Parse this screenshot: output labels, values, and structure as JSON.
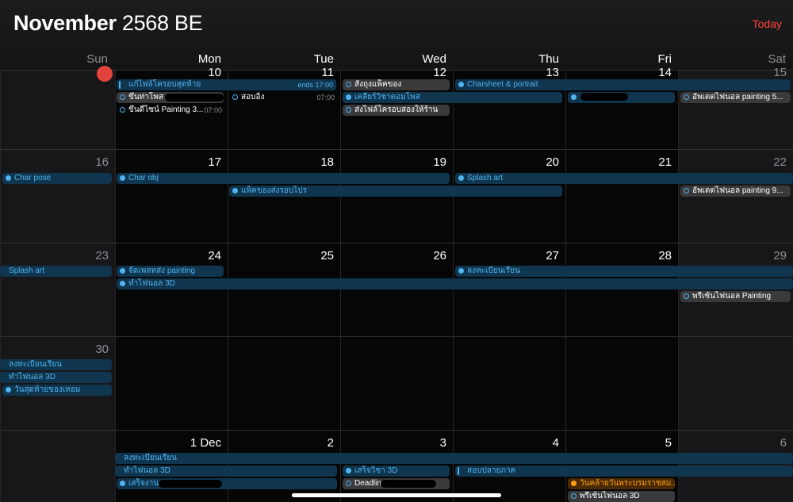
{
  "header": {
    "month": "November",
    "year": "2568 BE",
    "today_label": "Today"
  },
  "weekdays": [
    "Sun",
    "Mon",
    "Tue",
    "Wed",
    "Thu",
    "Fri",
    "Sat"
  ],
  "days": {
    "r1": [
      "",
      "10",
      "11",
      "12",
      "13",
      "14",
      "15"
    ],
    "r2": [
      "16",
      "17",
      "18",
      "19",
      "20",
      "21",
      "22"
    ],
    "r3": [
      "23",
      "24",
      "25",
      "26",
      "27",
      "28",
      "29"
    ],
    "r4": [
      "30",
      "",
      "",
      "",
      "",
      "",
      ""
    ],
    "r5": [
      "",
      "1 Dec",
      "2",
      "3",
      "4",
      "5",
      "6"
    ]
  },
  "events": {
    "e1": "แก้ไฟล์โครอบสุดท้าย",
    "e1_time": "ends 17:00",
    "e2": "สั่งถุงแพ็คของ",
    "e3": "Charsheet & portrait",
    "e4": "ขึ้นท่าโพส",
    "e5": "สอบอิ้ง",
    "e5_time": "07:00",
    "e6": "เคลียร์วิชาคอมโพส",
    "e7": "อัพเดตไฟนอล painting 5...",
    "e8": "ขึ้นดีไซน์ Painting 3...",
    "e8_time": "07:00",
    "e9": "ส่งไฟล์โครอบสองให้ร้าน",
    "e10": "Char pose",
    "e11": "Char obj",
    "e12": "Splash art",
    "e13": "แพ็คของส่งรอบไปร",
    "e14": "อัพเดตไฟนอล painting 9...",
    "e15": "Splash art",
    "e16": "จัดเพลทส่ง painting",
    "e17": "ลงทะเบียนเรียน",
    "e18": "ทำไฟนอล 3D",
    "e19": "พรีเซ้นไฟนอล Painting",
    "e20": "ลงทะเบียนเรียน",
    "e21": "ทำไฟนอล 3D",
    "e22": "วันสุดท้ายของเทอม",
    "e23": "ลงทะเบียนเรียน",
    "e24": "ทำไฟนอล 3D",
    "e25": "เสร็จวิชา 3D",
    "e26": "สอบปลายภาค",
    "e27": "เสร็จงาน",
    "e28": "Deadline",
    "e29": "วันคล้ายวันพระบรมราชสม...",
    "e30": "พรีเซ้นไฟนอล 3D"
  },
  "colors": {
    "accent_blue": "#4fb4ef",
    "today_red": "#ff453a",
    "holiday_orange": "#ff9f0a"
  }
}
